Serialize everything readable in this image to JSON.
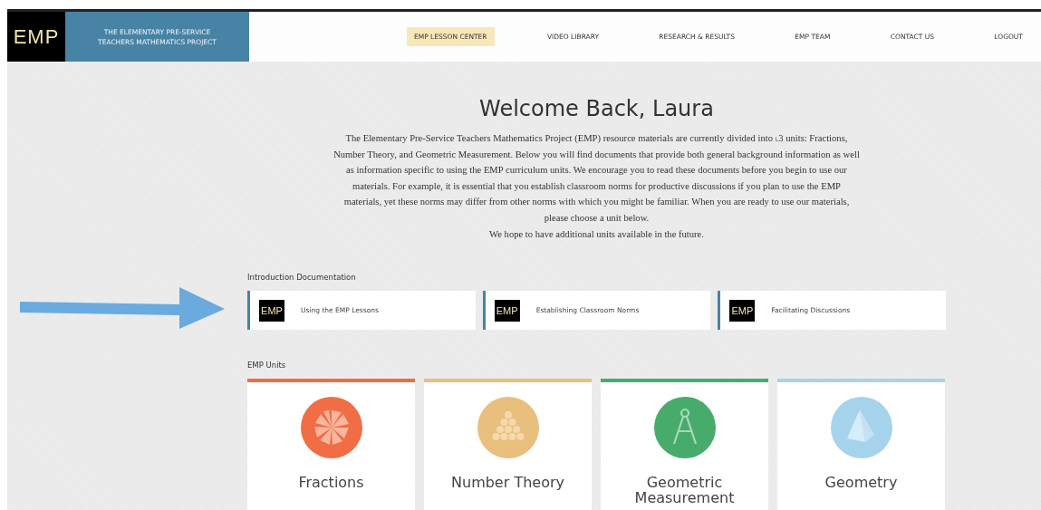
{
  "header": {
    "logo": "EMP",
    "project_title": [
      "THE ELEMENTARY PRE-SERVICE",
      "TEACHERS MATHEMATICS PROJECT"
    ],
    "nav": [
      {
        "label": "EMP LESSON CENTER",
        "selected": true
      },
      {
        "label": "VIDEO LIBRARY",
        "selected": false
      },
      {
        "label": "RESEARCH & RESULTS",
        "selected": false
      },
      {
        "label": "EMP TEAM",
        "selected": false
      },
      {
        "label": "CONTACT US",
        "selected": false
      },
      {
        "label": "LOGOUT",
        "selected": false
      }
    ]
  },
  "welcome": {
    "title": "Welcome Back, Laura",
    "paragraph": [
      "The Elementary Pre-Service Teachers Mathematics Project (EMP) resource materials are currently divided into ˪3 units: Fractions, Number Theory, and Geometric Measurement. Below you will find documents that provide both general background information as well as information specific to using the EMP curriculum units. We encourage you to read these documents before you begin to use our materials. For example, it is essential that you establish classroom norms for productive discussions if you plan to use the EMP materials, yet these norms may differ from other norms with which you might be familiar. When you are ready to use our materials, please choose a unit below.",
      "We hope to have additional units available in the future."
    ]
  },
  "intro_docs": {
    "heading": "Introduction Documentation",
    "items": [
      {
        "thumb": "EMP",
        "title": "Using the EMP Lessons"
      },
      {
        "thumb": "EMP",
        "title": "Establishing Classroom Norms"
      },
      {
        "thumb": "EMP",
        "title": "Facilitating Discussions"
      }
    ]
  },
  "units": {
    "heading": "EMP Units",
    "items": [
      {
        "kind": "fractions",
        "title": "Fractions",
        "color": "#f06d45"
      },
      {
        "kind": "numbers",
        "title": "Number Theory",
        "color": "#e9bf7e"
      },
      {
        "kind": "compass",
        "title": "Geometric Measurement",
        "color": "#47ab6c"
      },
      {
        "kind": "pyramid",
        "title": "Geometry",
        "color": "#a6d3ec"
      }
    ]
  }
}
